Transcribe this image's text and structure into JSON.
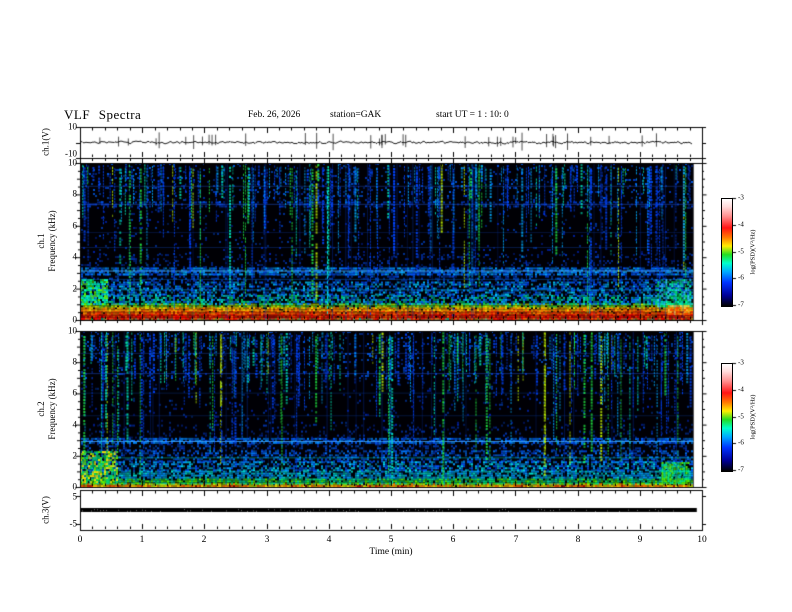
{
  "header": {
    "title": "VLF Spectra",
    "date": "Feb. 26, 2026",
    "station": "station=GAK",
    "start_ut": "start UT =  1 : 10: 0"
  },
  "xaxis": {
    "label": "Time (min)",
    "ticks": [
      "0",
      "1",
      "2",
      "3",
      "4",
      "5",
      "6",
      "7",
      "8",
      "9",
      "10"
    ],
    "range_min": [
      0,
      10
    ],
    "minor_tick_min": 0.2
  },
  "panels": {
    "ch1_wave": {
      "ylabel": "ch.1(V)",
      "yticks": [
        "10",
        "-10"
      ]
    },
    "sp1": {
      "ylabel_channel": "ch.1",
      "ylabel_axis": "Frequency (kHz)",
      "yticks": [
        "10",
        "8",
        "6",
        "4",
        "2",
        "0"
      ]
    },
    "sp2": {
      "ylabel_channel": "ch.2",
      "ylabel_axis": "Frequency (kHz)",
      "yticks": [
        "10",
        "8",
        "6",
        "4",
        "2",
        "0"
      ]
    },
    "ch3": {
      "ylabel": "ch.3(V)",
      "yticks": [
        "5",
        "-5"
      ]
    }
  },
  "colorbar": {
    "label": "log(PSD)(V²/Hz)",
    "ticks": [
      "-3",
      "-4",
      "-5",
      "-6",
      "-7"
    ],
    "gradient": [
      [
        "#ffffff",
        0
      ],
      [
        "#ffdcdc",
        7
      ],
      [
        "#ff9090",
        16
      ],
      [
        "#ff1414",
        27
      ],
      [
        "#ff7a00",
        36
      ],
      [
        "#ffee00",
        44
      ],
      [
        "#22dd22",
        52
      ],
      [
        "#00ffcc",
        60
      ],
      [
        "#00aaff",
        68
      ],
      [
        "#0033ff",
        78
      ],
      [
        "#000099",
        90
      ],
      [
        "#000000",
        100
      ]
    ]
  },
  "chart_data": [
    {
      "id": "ch1_waveform",
      "type": "line",
      "title": "ch.1(V)",
      "ylim": [
        -10,
        10
      ],
      "yticks": [
        10,
        -10
      ],
      "x_range_min": [
        0,
        9.85
      ],
      "signal": {
        "baseline_V": 0,
        "noise_amp_V": 1.5,
        "spike_count": 38,
        "spike_amp_V": [
          3,
          8
        ]
      }
    },
    {
      "id": "ch1_spectrogram",
      "type": "heatmap",
      "title": "ch.1 Frequency (kHz)",
      "freq_range_khz": [
        0,
        10
      ],
      "time_range_min": [
        0,
        9.85
      ],
      "psd_log_range": [
        -7,
        -3
      ],
      "bands": [
        {
          "f": [
            0.0,
            0.12
          ],
          "colors": [
            "#00bb44",
            "#00ddaa",
            "#dd2200"
          ],
          "density": 0.9
        },
        {
          "f": [
            0.12,
            0.4
          ],
          "colors": [
            "#ee0000",
            "#ff2200",
            "#ff5500"
          ],
          "density": 0.97
        },
        {
          "f": [
            0.4,
            0.62
          ],
          "colors": [
            "#ff5500",
            "#ff8800",
            "#ff3300"
          ],
          "density": 0.96
        },
        {
          "f": [
            0.62,
            0.82
          ],
          "colors": [
            "#ffaa00",
            "#ffdd00",
            "#ff7700"
          ],
          "density": 0.92
        },
        {
          "f": [
            0.82,
            1.05
          ],
          "colors": [
            "#99dd00",
            "#ccee00",
            "#33cc33"
          ],
          "density": 0.85
        },
        {
          "f": [
            1.05,
            1.6
          ],
          "colors": [
            "#0066ff",
            "#00aaff",
            "#00ddcc",
            "#00cc66"
          ],
          "density": 0.7
        },
        {
          "f": [
            1.6,
            2.45
          ],
          "colors": [
            "#0044ee",
            "#0077ff",
            "#00ccff"
          ],
          "density": 0.55
        },
        {
          "f": [
            2.45,
            2.95
          ],
          "colors": [
            "#0033bb",
            "#0055dd"
          ],
          "density": 0.3
        },
        {
          "f": [
            2.95,
            3.35
          ],
          "colors": [
            "#0055ff",
            "#0077ff",
            "#00aaff"
          ],
          "density": 0.75
        },
        {
          "f": [
            3.35,
            4.2
          ],
          "colors": [
            "#0033aa",
            "#002288"
          ],
          "density": 0.16
        },
        {
          "f": [
            4.2,
            7.2
          ],
          "colors": [
            "#0022aa",
            "#003399"
          ],
          "density": 0.05
        },
        {
          "f": [
            7.2,
            7.55
          ],
          "colors": [
            "#0044dd",
            "#0033bb"
          ],
          "density": 0.3
        },
        {
          "f": [
            7.55,
            10.0
          ],
          "colors": [
            "#0033bb",
            "#0055dd"
          ],
          "density": 0.1
        }
      ],
      "hlines": [
        {
          "f": 3.15,
          "color": "#44aaff",
          "alpha": 0.85,
          "w": 1
        },
        {
          "f": 1.95,
          "color": "#00aaff",
          "alpha": 0.55,
          "w": 1
        },
        {
          "f": 7.4,
          "color": "#2255dd",
          "alpha": 0.5,
          "w": 1
        },
        {
          "f": 4.65,
          "color": "#1144bb",
          "alpha": 0.35,
          "w": 1
        },
        {
          "f": 5.6,
          "color": "#1144bb",
          "alpha": 0.28,
          "w": 1
        },
        {
          "f": 2.62,
          "color": "#0077ee",
          "alpha": 0.4,
          "w": 1
        },
        {
          "f": 8.55,
          "color": "#2255dd",
          "alpha": 0.4,
          "w": 1
        }
      ],
      "streaks": {
        "count": 240,
        "palette": [
          [
            "#0044ff",
            0.5
          ],
          [
            "#00aaff",
            0.2
          ],
          [
            "#00eebb",
            0.14
          ],
          [
            "#22ee44",
            0.11
          ],
          [
            "#ccff00",
            0.05
          ]
        ]
      },
      "faint_streaks": 26,
      "blobs": [
        {
          "t": [
            0.0,
            0.45
          ],
          "f": [
            1.0,
            2.6
          ],
          "colors": [
            "#00ee66",
            "#00ffcc",
            "#66ff00"
          ],
          "density": 0.75
        },
        {
          "t": [
            9.25,
            9.8
          ],
          "f": [
            0.9,
            2.6
          ],
          "colors": [
            "#00dd55",
            "#00ffaa",
            "#33ccff"
          ],
          "density": 0.65
        },
        {
          "t": [
            9.45,
            9.78
          ],
          "f": [
            0.35,
            0.95
          ],
          "colors": [
            "#ff8800",
            "#ffcc44",
            "#ff4400"
          ],
          "density": 0.9
        }
      ],
      "vline": {
        "t": 3.97,
        "f": [
          0.4,
          8.2
        ],
        "color": "#00ffff"
      }
    },
    {
      "id": "ch2_spectrogram",
      "type": "heatmap",
      "title": "ch.2 Frequency (kHz)",
      "freq_range_khz": [
        0,
        10
      ],
      "time_range_min": [
        0,
        9.85
      ],
      "psd_log_range": [
        -7,
        -3
      ],
      "bands": [
        {
          "f": [
            0.0,
            0.1
          ],
          "colors": [
            "#cc0000",
            "#ff2200"
          ],
          "density": 0.95
        },
        {
          "f": [
            0.1,
            0.24
          ],
          "colors": [
            "#ffee00",
            "#aadd00",
            "#ff8800"
          ],
          "density": 0.9
        },
        {
          "f": [
            0.24,
            0.55
          ],
          "colors": [
            "#00dd66",
            "#55ee00",
            "#00ccaa"
          ],
          "density": 0.85
        },
        {
          "f": [
            0.55,
            1.05
          ],
          "colors": [
            "#00aaee",
            "#00ddcc",
            "#0088ff"
          ],
          "density": 0.75
        },
        {
          "f": [
            1.05,
            1.65
          ],
          "colors": [
            "#0055ff",
            "#0099ff",
            "#00ddee"
          ],
          "density": 0.6
        },
        {
          "f": [
            1.65,
            2.35
          ],
          "colors": [
            "#0044dd",
            "#0077ff"
          ],
          "density": 0.45
        },
        {
          "f": [
            2.35,
            2.8
          ],
          "colors": [
            "#0033bb",
            "#0055dd"
          ],
          "density": 0.28
        },
        {
          "f": [
            2.8,
            3.15
          ],
          "colors": [
            "#0055ff",
            "#0088ff"
          ],
          "density": 0.7
        },
        {
          "f": [
            3.15,
            4.0
          ],
          "colors": [
            "#0033aa",
            "#002288"
          ],
          "density": 0.14
        },
        {
          "f": [
            4.0,
            7.0
          ],
          "colors": [
            "#0022aa",
            "#003399"
          ],
          "density": 0.05
        },
        {
          "f": [
            7.0,
            10.0
          ],
          "colors": [
            "#0033bb",
            "#0055dd"
          ],
          "density": 0.1
        }
      ],
      "hlines": [
        {
          "f": 2.95,
          "color": "#44aaff",
          "alpha": 0.8,
          "w": 1
        },
        {
          "f": 1.9,
          "color": "#00ffcc",
          "alpha": 0.4,
          "w": 1
        },
        {
          "f": 6.05,
          "color": "#1144bb",
          "alpha": 0.3,
          "w": 1
        },
        {
          "f": 4.6,
          "color": "#1144bb",
          "alpha": 0.3,
          "w": 1
        },
        {
          "f": 7.3,
          "color": "#2255dd",
          "alpha": 0.45,
          "w": 1
        },
        {
          "f": 8.6,
          "color": "#2255dd",
          "alpha": 0.35,
          "w": 1
        }
      ],
      "streaks": {
        "count": 260,
        "palette": [
          [
            "#0044ff",
            0.48
          ],
          [
            "#00aaff",
            0.2
          ],
          [
            "#00eebb",
            0.15
          ],
          [
            "#22ee44",
            0.12
          ],
          [
            "#ccff00",
            0.05
          ]
        ]
      },
      "faint_streaks": 30,
      "blobs": [
        {
          "t": [
            0.0,
            0.6
          ],
          "f": [
            0.3,
            2.3
          ],
          "colors": [
            "#66ee00",
            "#00dd66",
            "#ffee00"
          ],
          "density": 0.75
        },
        {
          "t": [
            9.35,
            9.8
          ],
          "f": [
            0.3,
            1.6
          ],
          "colors": [
            "#55ee00",
            "#00ee88"
          ],
          "density": 0.85
        }
      ]
    },
    {
      "id": "ch3_line",
      "type": "line",
      "title": "ch.3(V)",
      "ylim": [
        -5,
        5
      ],
      "yticks": [
        5,
        -5
      ],
      "constant_value_V": 0,
      "x_range_min": [
        0,
        9.9
      ],
      "thickness_px": 4
    }
  ]
}
